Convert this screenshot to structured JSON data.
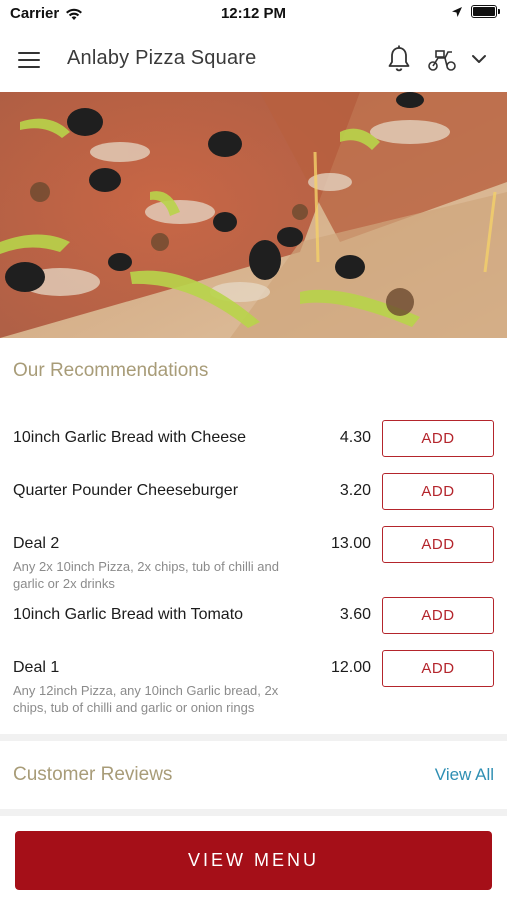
{
  "status": {
    "carrier": "Carrier",
    "time": "12:12 PM"
  },
  "header": {
    "title": "Anlaby Pizza Square",
    "icons": [
      "menu-icon",
      "bell-icon",
      "delivery-icon",
      "chevron-down-icon"
    ]
  },
  "hero": {
    "image": "pizza-photo"
  },
  "recommendations": {
    "title": "Our Recommendations",
    "add_label": "ADD",
    "items": [
      {
        "name": "10inch Garlic Bread with Cheese",
        "description": "",
        "price": "4.30"
      },
      {
        "name": "Quarter Pounder Cheeseburger",
        "description": "",
        "price": "3.20"
      },
      {
        "name": "Deal 2",
        "description": "Any 2x 10inch Pizza, 2x chips, tub of chilli and garlic or 2x drinks",
        "price": "13.00"
      },
      {
        "name": "10inch Garlic Bread with Tomato",
        "description": "",
        "price": "3.60"
      },
      {
        "name": "Deal 1",
        "description": "Any 12inch Pizza, any 10inch Garlic bread, 2x chips, tub of chilli and garlic or onion rings",
        "price": "12.00"
      }
    ]
  },
  "reviews": {
    "title": "Customer Reviews",
    "view_all": "View All"
  },
  "footer": {
    "view_menu": "VIEW MENU"
  },
  "colors": {
    "accent": "#a50f18",
    "section_title": "#a89c78",
    "link": "#2f8fb3"
  }
}
